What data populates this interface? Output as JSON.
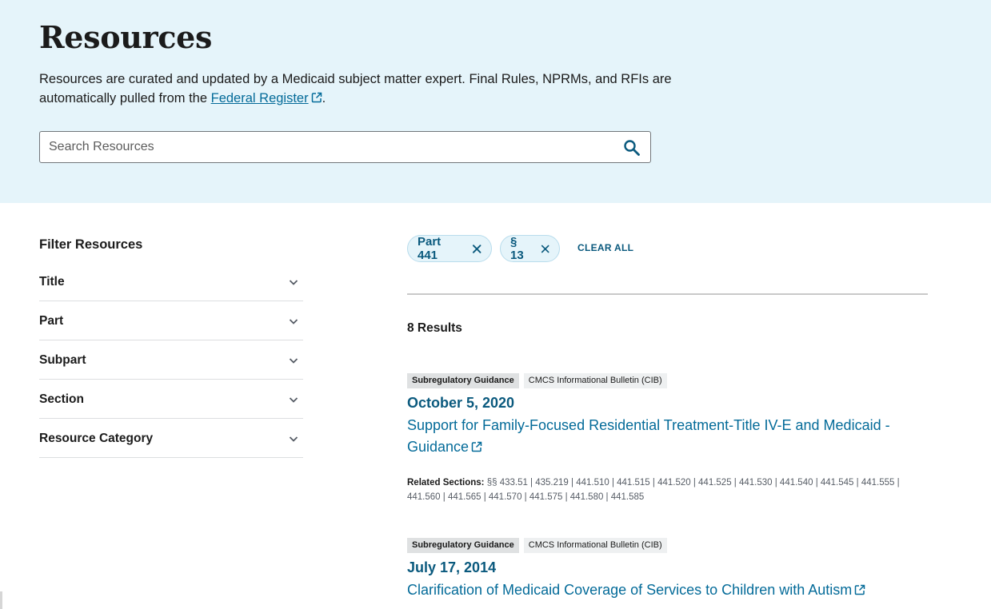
{
  "header": {
    "title": "Resources",
    "intro_text": "Resources are curated and updated by a Medicaid subject matter expert. Final Rules, NPRMs, and RFIs are automatically pulled from the",
    "intro_link": "Federal Register",
    "intro_end": "."
  },
  "search": {
    "placeholder": "Search Resources"
  },
  "sidebar": {
    "heading": "Filter Resources",
    "filters": [
      {
        "label": "Title"
      },
      {
        "label": "Part"
      },
      {
        "label": "Subpart"
      },
      {
        "label": "Section"
      },
      {
        "label": "Resource Category"
      }
    ]
  },
  "active_filters": {
    "chips": [
      {
        "label": "Part 441"
      },
      {
        "label": "§ 13"
      }
    ],
    "clear_all": "CLEAR ALL"
  },
  "results": {
    "count_text": "8 Results",
    "items": [
      {
        "tag_primary": "Subregulatory Guidance",
        "tag_secondary": "CMCS Informational Bulletin (CIB)",
        "date": "October 5, 2020",
        "title": "Support for Family-Focused Residential Treatment-Title IV-E and Medicaid - Guidance",
        "related_label": "Related Sections:",
        "related_sections": "§§ 433.51 | 435.219 | 441.510 | 441.515 | 441.520 | 441.525 | 441.530 | 441.540 | 441.545 | 441.555 | 441.560 | 441.565 | 441.570 | 441.575 | 441.580 | 441.585"
      },
      {
        "tag_primary": "Subregulatory Guidance",
        "tag_secondary": "CMCS Informational Bulletin (CIB)",
        "date": "July 17, 2014",
        "title": "Clarification of Medicaid Coverage of Services to Children with Autism"
      }
    ]
  },
  "colors": {
    "hero_bg": "#e5f4fa",
    "link": "#046b99",
    "accent_dark": "#0b5a7e"
  },
  "icons": {
    "search": "search-icon",
    "external": "external-link-icon",
    "chevron": "chevron-down-icon",
    "close": "close-icon"
  }
}
